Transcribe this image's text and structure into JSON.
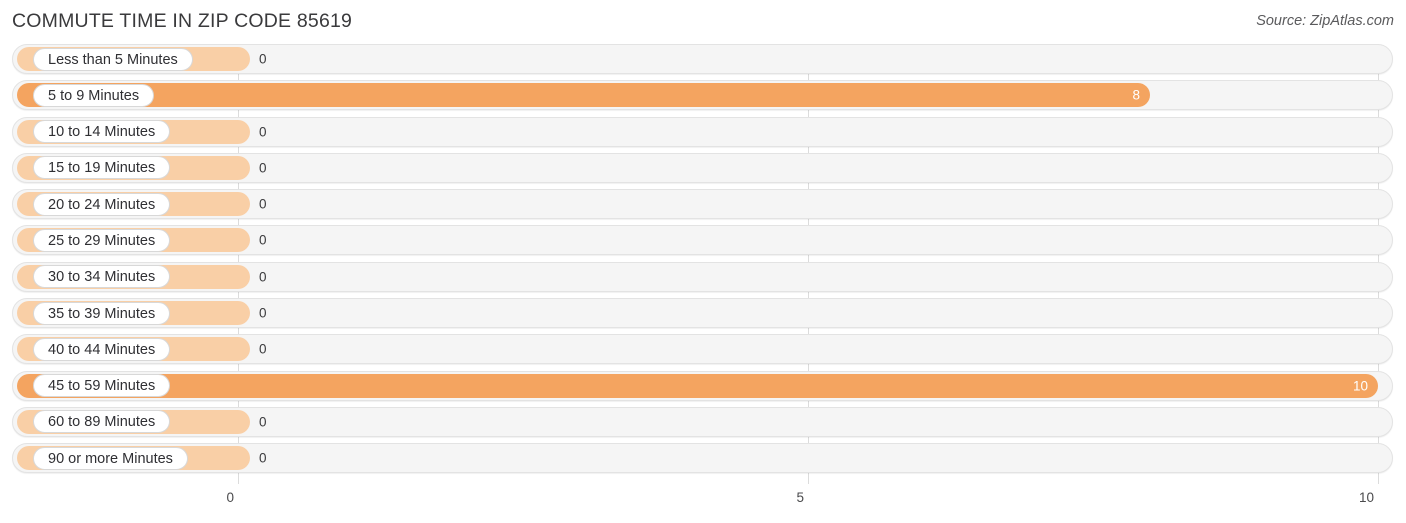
{
  "header": {
    "title": "COMMUTE TIME IN ZIP CODE 85619",
    "source": "Source: ZipAtlas.com"
  },
  "colors": {
    "bar_zero": "#f9cfa6",
    "bar_value": "#f4a460",
    "track": "#f5f5f5",
    "gridline": "#dcdcdc",
    "label_text": "#2f2f33"
  },
  "chart_data": {
    "type": "bar",
    "orientation": "horizontal",
    "title": "COMMUTE TIME IN ZIP CODE 85619",
    "xlabel": "",
    "ylabel": "",
    "xlim": [
      0,
      10
    ],
    "ticks": [
      "0",
      "5",
      "10"
    ],
    "tick_values": [
      0,
      5,
      10
    ],
    "grid": true,
    "legend": "none",
    "categories": [
      "Less than 5 Minutes",
      "5 to 9 Minutes",
      "10 to 14 Minutes",
      "15 to 19 Minutes",
      "20 to 24 Minutes",
      "25 to 29 Minutes",
      "30 to 34 Minutes",
      "35 to 39 Minutes",
      "40 to 44 Minutes",
      "45 to 59 Minutes",
      "60 to 89 Minutes",
      "90 or more Minutes"
    ],
    "values": [
      0,
      8,
      0,
      0,
      0,
      0,
      0,
      0,
      0,
      10,
      0,
      0
    ],
    "value_labels": [
      "0",
      "8",
      "0",
      "0",
      "0",
      "0",
      "0",
      "0",
      "0",
      "10",
      "0",
      "0"
    ]
  },
  "rows": [
    {
      "label": "Less than 5 Minutes",
      "value_label": "0",
      "value": 0
    },
    {
      "label": "5 to 9 Minutes",
      "value_label": "8",
      "value": 8
    },
    {
      "label": "10 to 14 Minutes",
      "value_label": "0",
      "value": 0
    },
    {
      "label": "15 to 19 Minutes",
      "value_label": "0",
      "value": 0
    },
    {
      "label": "20 to 24 Minutes",
      "value_label": "0",
      "value": 0
    },
    {
      "label": "25 to 29 Minutes",
      "value_label": "0",
      "value": 0
    },
    {
      "label": "30 to 34 Minutes",
      "value_label": "0",
      "value": 0
    },
    {
      "label": "35 to 39 Minutes",
      "value_label": "0",
      "value": 0
    },
    {
      "label": "40 to 44 Minutes",
      "value_label": "0",
      "value": 0
    },
    {
      "label": "45 to 59 Minutes",
      "value_label": "10",
      "value": 10
    },
    {
      "label": "60 to 89 Minutes",
      "value_label": "0",
      "value": 0
    },
    {
      "label": "90 or more Minutes",
      "value_label": "0",
      "value": 0
    }
  ],
  "axis": {
    "ticks": [
      "0",
      "5",
      "10"
    ]
  }
}
